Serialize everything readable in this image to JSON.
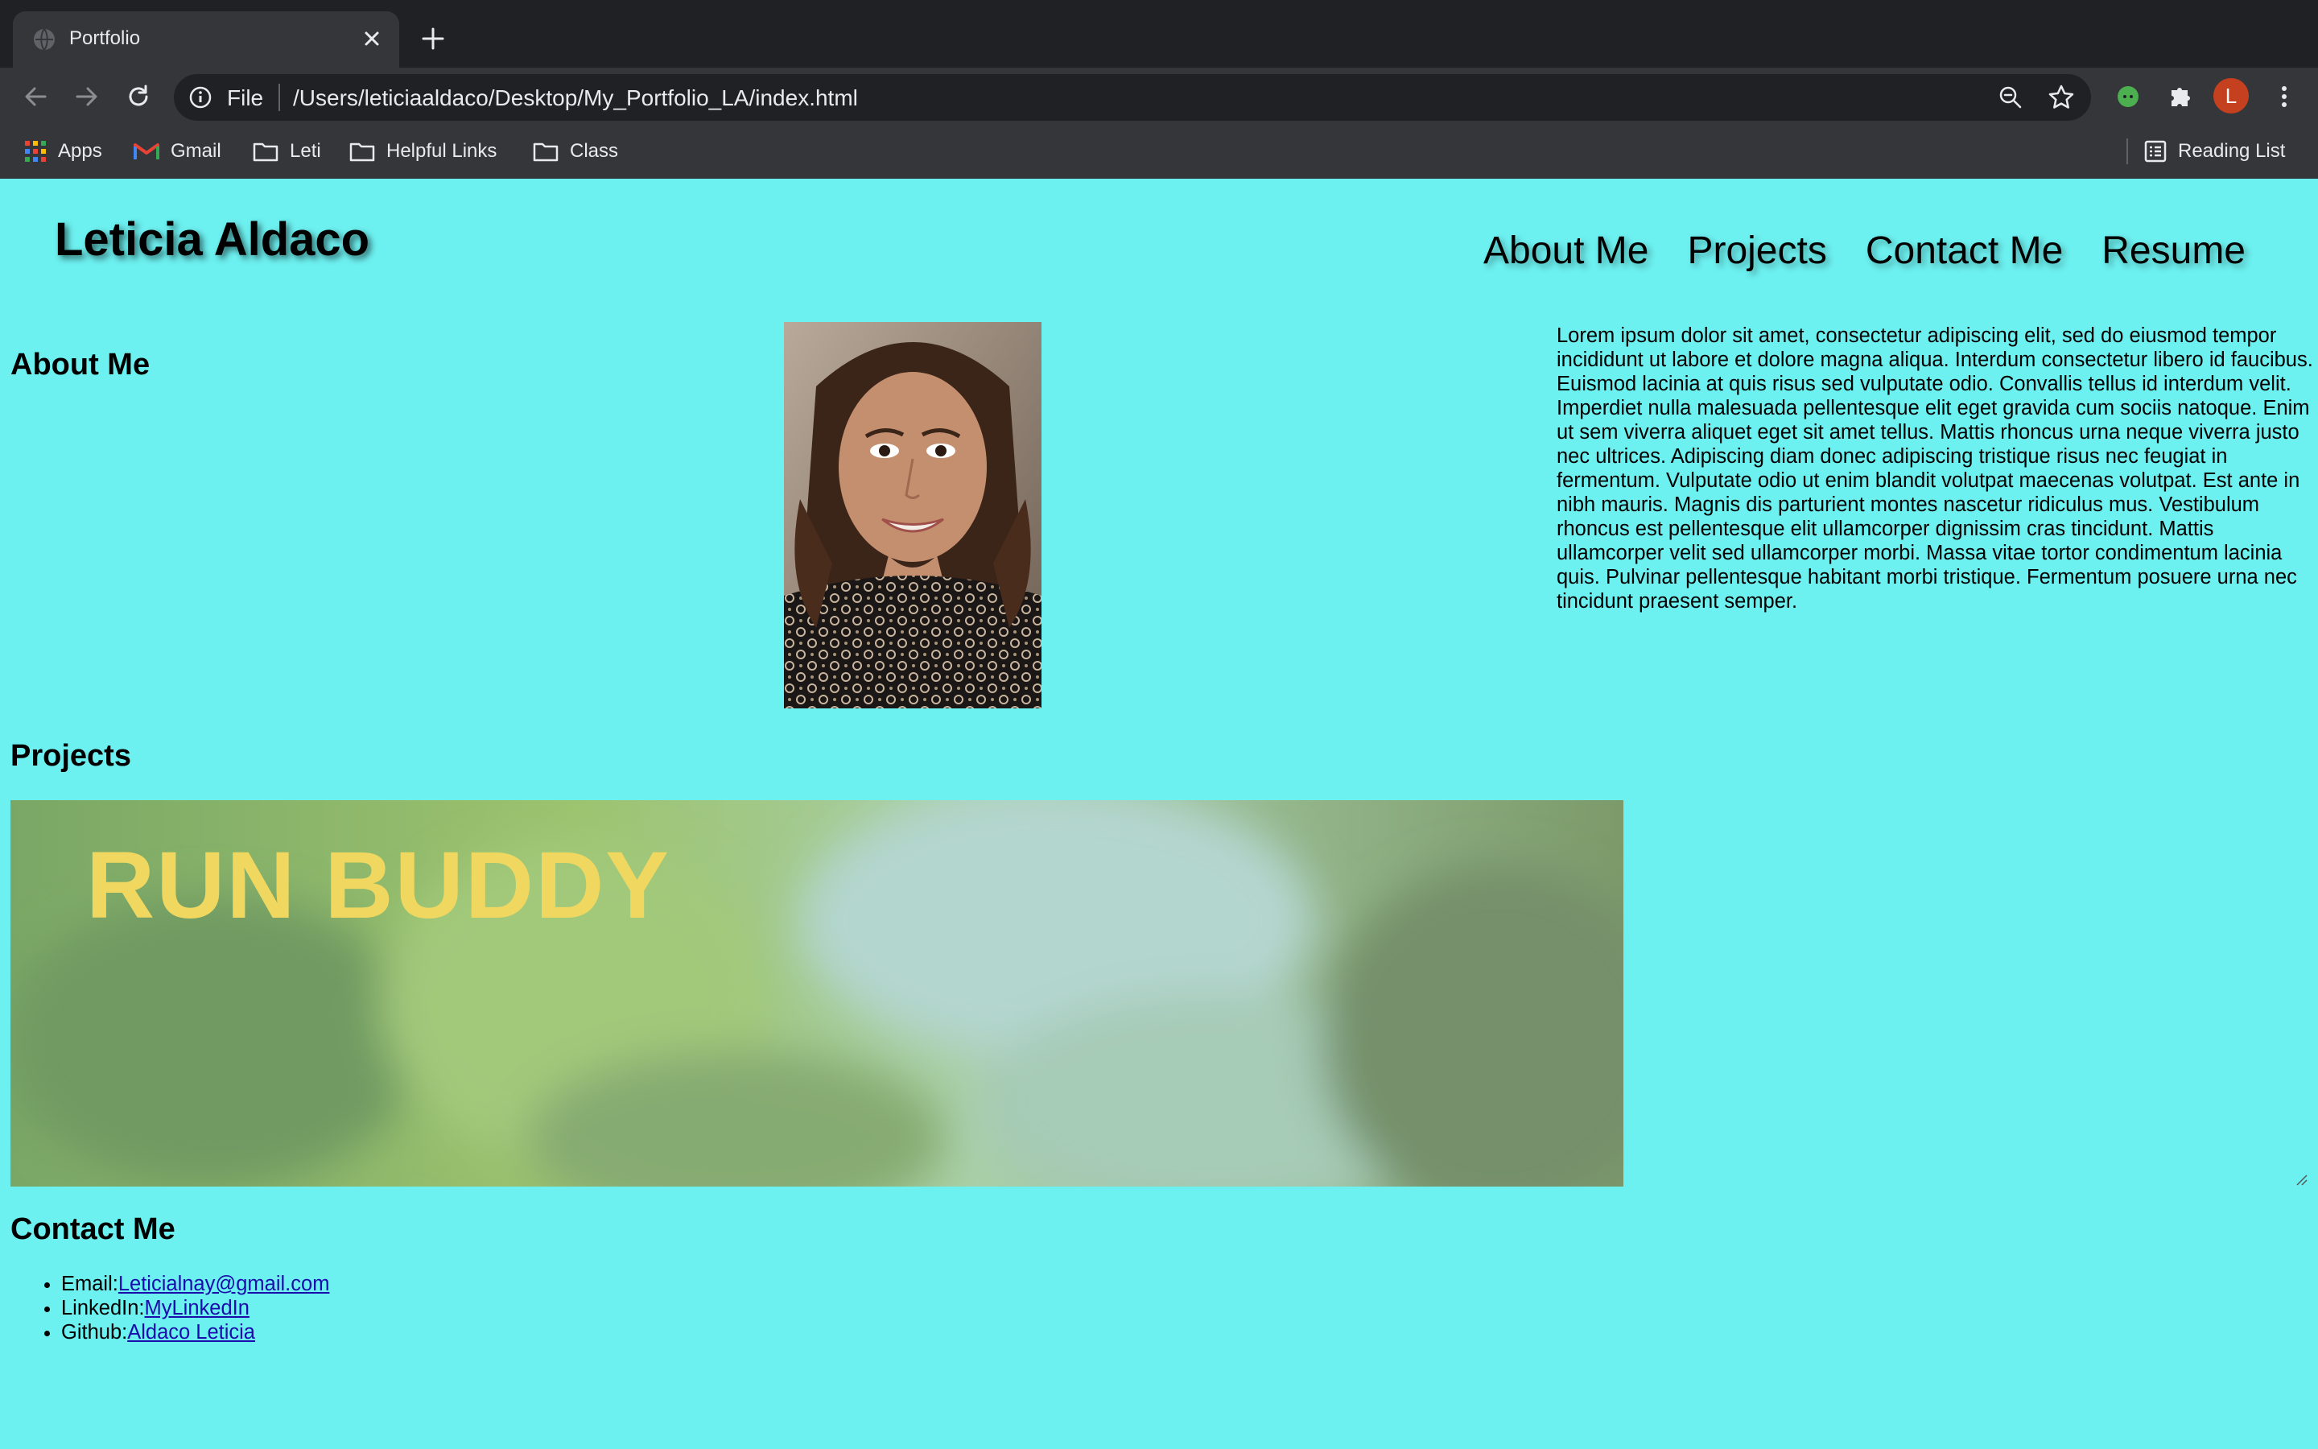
{
  "browser": {
    "tab_title": "Portfolio",
    "url_scheme": "File",
    "url": "/Users/leticiaaldaco/Desktop/My_Portfolio_LA/index.html",
    "profile_initial": "L",
    "bookmarks": [
      {
        "label": "Apps",
        "icon": "apps-grid-icon"
      },
      {
        "label": "Gmail",
        "icon": "gmail-icon"
      },
      {
        "label": "Leti",
        "icon": "folder-icon"
      },
      {
        "label": "Helpful Links",
        "icon": "folder-icon"
      },
      {
        "label": "Class",
        "icon": "folder-icon"
      }
    ],
    "reading_list": "Reading List"
  },
  "site": {
    "name": "Leticia Aldaco",
    "nav": [
      "About Me",
      "Projects",
      "Contact Me",
      "Resume"
    ]
  },
  "about": {
    "heading": "About Me",
    "text": "Lorem ipsum dolor sit amet, consectetur adipiscing elit, sed do eiusmod tempor incididunt ut labore et dolore magna aliqua. Interdum consectetur libero id faucibus. Euismod lacinia at quis risus sed vulputate odio. Convallis tellus id interdum velit. Imperdiet nulla malesuada pellentesque elit eget gravida cum sociis natoque. Enim ut sem viverra aliquet eget sit amet tellus. Mattis rhoncus urna neque viverra justo nec ultrices. Adipiscing diam donec adipiscing tristique risus nec feugiat in fermentum. Vulputate odio ut enim blandit volutpat maecenas volutpat. Est ante in nibh mauris. Magnis dis parturient montes nascetur ridiculus mus. Vestibulum rhoncus est pellentesque elit ullamcorper dignissim cras tincidunt. Mattis ullamcorper velit sed ullamcorper morbi. Massa vitae tortor condimentum lacinia quis. Pulvinar pellentesque habitant morbi tristique. Fermentum posuere urna nec tincidunt praesent semper."
  },
  "projects": {
    "heading": "Projects",
    "items": [
      {
        "title": "RUN BUDDY"
      }
    ]
  },
  "contact": {
    "heading": "Contact Me",
    "items": [
      {
        "label": "Email:",
        "link": "Leticialnay@gmail.com"
      },
      {
        "label": "LinkedIn:",
        "link": "MyLinkedIn"
      },
      {
        "label": "Github:",
        "link": "Aldaco Leticia"
      }
    ]
  },
  "colors": {
    "page_bg": "#6df0f0",
    "chrome_bg": "#35363a",
    "tabstrip_bg": "#202124",
    "project_title": "#f0d860",
    "link": "#1a0dab"
  }
}
